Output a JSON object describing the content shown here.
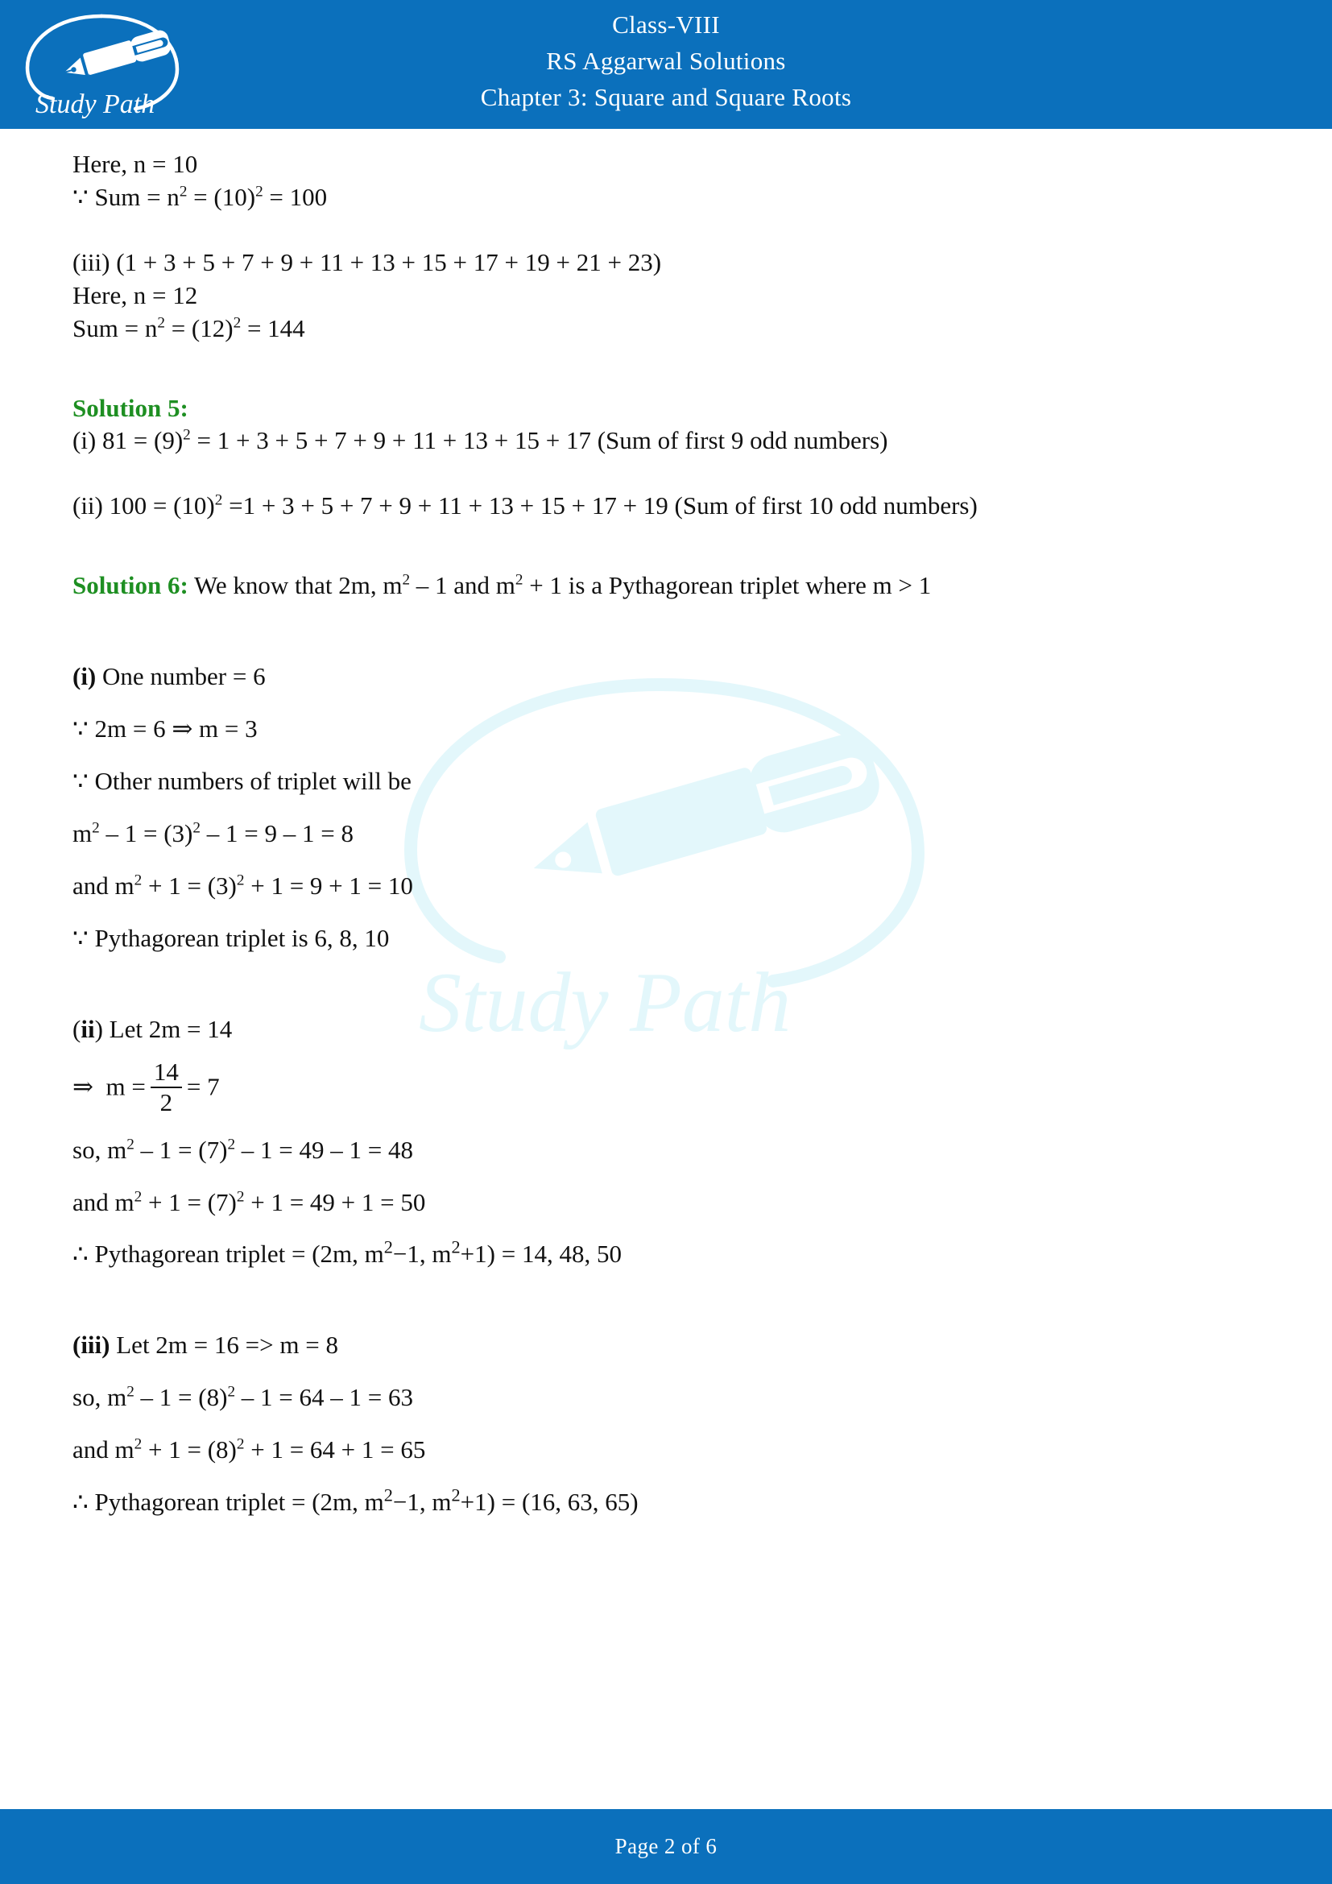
{
  "header": {
    "logo_alt": "Study Path",
    "logo_text": "Study Path",
    "line1": "Class-VIII",
    "line2": "RS Aggarwal Solutions",
    "line3": "Chapter 3: Square and Square Roots"
  },
  "watermark": {
    "text": "Study Path"
  },
  "body": {
    "l1": "Here, n = 10",
    "l2_prefix": "∵ Sum = n",
    "l2_exp1": "2",
    "l2_mid": " = (10)",
    "l2_exp2": "2",
    "l2_end": " = 100",
    "l3": "(iii) (1 + 3 + 5 + 7 + 9 + 11 + 13 + 15 + 17 + 19 + 21 + 23)",
    "l4": "Here, n = 12",
    "l5_prefix": "Sum = n",
    "l5_exp1": "2",
    "l5_mid": " = (12)",
    "l5_exp2": "2",
    "l5_end": " = 144",
    "sol5_head": "Solution 5:",
    "sol5_i_prefix": "(i) 81 = (9)",
    "sol5_i_exp": "2",
    "sol5_i_end": " = 1 + 3 + 5 + 7 + 9 + 11 + 13 + 15 + 17 (Sum of first 9 odd numbers)",
    "sol5_ii_prefix": "(ii) 100 = (10)",
    "sol5_ii_exp": "2",
    "sol5_ii_end": " =1 + 3 + 5 + 7 + 9 + 11 + 13 + 15 + 17 + 19 (Sum of first 10 odd numbers)",
    "sol6_head": "Solution 6:",
    "sol6_intro_a": " We know that 2m, m",
    "sol6_intro_exp1": "2",
    "sol6_intro_b": " – 1 and m",
    "sol6_intro_exp2": "2",
    "sol6_intro_c": " + 1 is a Pythagorean triplet where m > 1",
    "i_label": "(i)",
    "i_l1": " One number = 6",
    "i_l2": "∵ 2m = 6 ⇒ m = 3",
    "i_l3": "∵ Other numbers of triplet will be",
    "i_l4_a": "m",
    "i_l4_exp1": "2",
    "i_l4_b": " – 1 = (3)",
    "i_l4_exp2": "2",
    "i_l4_c": " – 1 = 9 – 1 = 8",
    "i_l5_a": "and m",
    "i_l5_exp1": "2",
    "i_l5_b": " + 1 = (3)",
    "i_l5_exp2": "2",
    "i_l5_c": " + 1 = 9 + 1 = 10",
    "i_l6": "∵ Pythagorean triplet is 6, 8, 10",
    "ii_label": "(ii",
    "ii_label_close": ") Let 2m  =  14",
    "ii_arrow": "⇒",
    "ii_m": "m =",
    "ii_num": "14",
    "ii_den": "2",
    "ii_eq7": "= 7",
    "ii_l3_a": "so, m",
    "ii_l3_exp1": "2",
    "ii_l3_b": " – 1 = (7)",
    "ii_l3_exp2": "2",
    "ii_l3_c": " – 1 = 49 – 1 = 48",
    "ii_l4_a": "and m",
    "ii_l4_exp1": "2",
    "ii_l4_b": " + 1 = (7)",
    "ii_l4_exp2": "2",
    "ii_l4_c": " + 1 = 49 + 1 = 50",
    "ii_l5_a": "∴ Pythagorean triplet = (2m, m",
    "ii_l5_exp1": "2",
    "ii_l5_b": "−1, m",
    "ii_l5_exp2": "2",
    "ii_l5_c": "+1) = 14, 48, 50",
    "iii_label": "(iii)",
    "iii_l1": " Let 2m = 16 => m = 8",
    "iii_l2_a": "so, m",
    "iii_l2_exp1": "2",
    "iii_l2_b": " – 1 = (8)",
    "iii_l2_exp2": "2",
    "iii_l2_c": " – 1 = 64 – 1 = 63",
    "iii_l3_a": "and m",
    "iii_l3_exp1": "2",
    "iii_l3_b": " + 1 = (8)",
    "iii_l3_exp2": "2",
    "iii_l3_c": " + 1 = 64 + 1 = 65",
    "iii_l4_a": "∴ Pythagorean triplet = (2m, m",
    "iii_l4_exp1": "2",
    "iii_l4_b": "−1, m",
    "iii_l4_exp2": "2",
    "iii_l4_c": "+1) = (16, 63, 65)"
  },
  "footer": {
    "page_text": "Page 2 of 6"
  },
  "colors": {
    "brand_blue": "#0B70BC",
    "solution_green": "#1E8F22",
    "watermark_cyan": "#E3F7FB",
    "text": "#111111"
  }
}
